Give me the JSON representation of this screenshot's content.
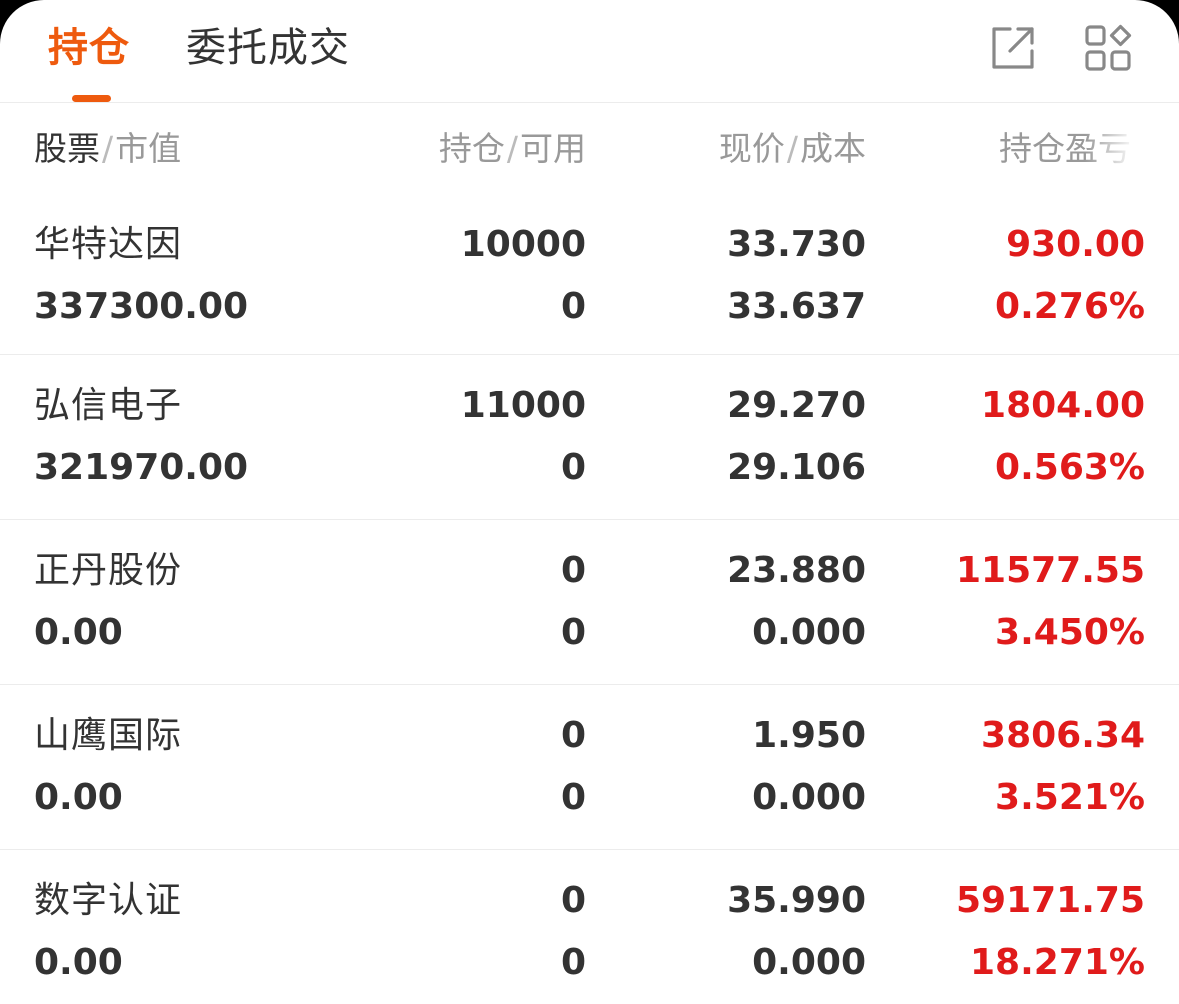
{
  "tabs": [
    {
      "label": "持仓",
      "active": true
    },
    {
      "label": "委托成交",
      "active": false
    }
  ],
  "toolbar": {
    "share_icon": "external-link-icon",
    "layout_icon": "grid-layout-icon"
  },
  "header": {
    "col1": {
      "a": "股票",
      "b": "市值"
    },
    "col2": {
      "a": "持仓",
      "b": "可用"
    },
    "col3": {
      "a": "现价",
      "b": "成本"
    },
    "col4": {
      "a": "持仓盈亏"
    }
  },
  "colors": {
    "accent": "#ee5a0e",
    "profit": "#e01b1b",
    "text": "#333333",
    "muted": "#999999"
  },
  "holdings": [
    {
      "name": "华特达因",
      "market_value": "337300.00",
      "position": "10000",
      "available": "0",
      "price": "33.730",
      "cost": "33.637",
      "pnl": "930.00",
      "pnl_pct": "0.276%"
    },
    {
      "name": "弘信电子",
      "market_value": "321970.00",
      "position": "11000",
      "available": "0",
      "price": "29.270",
      "cost": "29.106",
      "pnl": "1804.00",
      "pnl_pct": "0.563%"
    },
    {
      "name": "正丹股份",
      "market_value": "0.00",
      "position": "0",
      "available": "0",
      "price": "23.880",
      "cost": "0.000",
      "pnl": "11577.55",
      "pnl_pct": "3.450%"
    },
    {
      "name": "山鹰国际",
      "market_value": "0.00",
      "position": "0",
      "available": "0",
      "price": "1.950",
      "cost": "0.000",
      "pnl": "3806.34",
      "pnl_pct": "3.521%"
    },
    {
      "name": "数字认证",
      "market_value": "0.00",
      "position": "0",
      "available": "0",
      "price": "35.990",
      "cost": "0.000",
      "pnl": "59171.75",
      "pnl_pct": "18.271%"
    }
  ]
}
